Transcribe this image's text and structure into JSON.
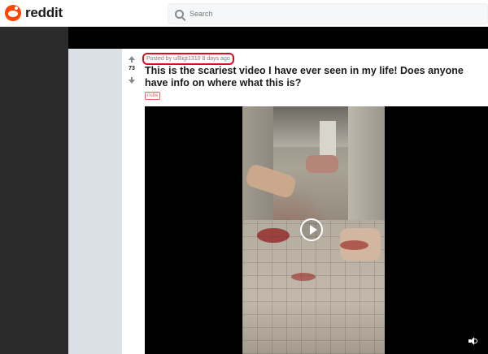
{
  "header": {
    "logo_text": "reddit",
    "search_placeholder": "Search"
  },
  "post": {
    "vote_count": "73",
    "meta": "Posted by u/Bigt1310 8 days ago",
    "title": "This is the scariest video I have ever seen in my life! Does anyone have info on where what this is?",
    "flair": "nsfw"
  },
  "icons": {
    "logo": "reddit-logo",
    "search": "search-icon",
    "upvote": "upvote-arrow-icon",
    "downvote": "downvote-arrow-icon",
    "play": "play-icon",
    "volume": "volume-icon"
  },
  "colors": {
    "brand": "#ff4500",
    "meta_highlight": "#d40f1f",
    "nsfw": "#ff585b",
    "gutter": "#dae0e6"
  }
}
